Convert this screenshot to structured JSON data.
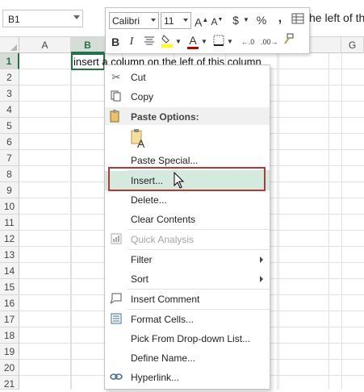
{
  "name_box": {
    "value": "B1"
  },
  "formula_overflow": "he left of th",
  "columns": [
    {
      "letter": "A",
      "selected": false
    },
    {
      "letter": "B",
      "selected": true
    },
    {
      "letter": "G",
      "selected": false
    }
  ],
  "rows": [
    "1",
    "2",
    "3",
    "4",
    "5",
    "6",
    "7",
    "8",
    "9",
    "10",
    "11",
    "12",
    "13",
    "14",
    "15",
    "16",
    "17",
    "18",
    "19",
    "20",
    "21"
  ],
  "selected_row": "1",
  "cell_b1": "insert a column on the left of this column",
  "mini_toolbar": {
    "font_name": "Calibri",
    "font_size": "11",
    "increase_font": "A",
    "decrease_font": "A",
    "currency": "$",
    "percent": "%",
    "comma": ",",
    "bold": "B",
    "italic": "I",
    "font_color_letter": "A",
    "font_color": "#c00000",
    "fill_color": "#ffff00"
  },
  "context_menu": {
    "cut": "Cut",
    "copy": "Copy",
    "paste_options_header": "Paste Options:",
    "paste_special": "Paste Special...",
    "insert": "Insert...",
    "delete": "Delete...",
    "clear_contents": "Clear Contents",
    "quick_analysis": "Quick Analysis",
    "filter": "Filter",
    "sort": "Sort",
    "insert_comment": "Insert Comment",
    "format_cells": "Format Cells...",
    "pick_from_list": "Pick From Drop-down List...",
    "define_name": "Define Name...",
    "hyperlink": "Hyperlink..."
  },
  "colors": {
    "excel_green": "#217346",
    "highlight_box": "#b33a3a",
    "hover": "#d4eadc"
  }
}
